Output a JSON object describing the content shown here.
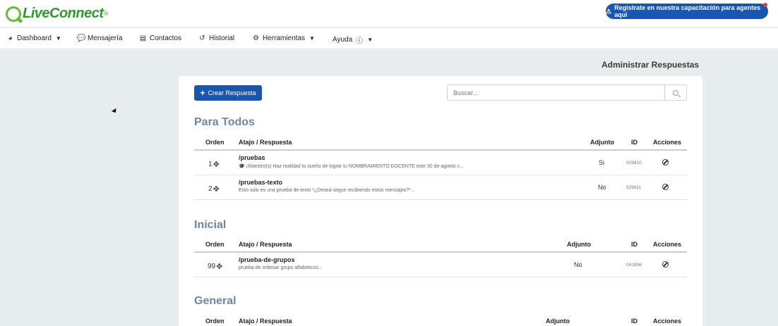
{
  "app": {
    "logo_text": "LiveConnect",
    "logo_mark": "®",
    "cta_label": "Registrate en nuestra capacitación para agentes aqui",
    "cta_icon": "warning-icon"
  },
  "nav": {
    "items": [
      {
        "label": "Dashboard",
        "icon": "dashboard-icon"
      },
      {
        "label": "Mensajería",
        "icon": "chat-icon"
      },
      {
        "label": "Contactos",
        "icon": "contacts-card-icon"
      },
      {
        "label": "Historial",
        "icon": "history-icon"
      },
      {
        "label": "Herramientas",
        "icon": "tools-icon"
      },
      {
        "label": "Ayuda",
        "icon": "help-icon"
      }
    ]
  },
  "page": {
    "title": "Administrar Respuestas",
    "create_button": "Crear Respuesta",
    "search_placeholder": "Buscar..."
  },
  "columns": {
    "orden": "Orden",
    "atajo": "Atajo / Respuesta",
    "adjunto": "Adjunto",
    "id": "ID",
    "acciones": "Acciones"
  },
  "sections": [
    {
      "title": "Para Todos",
      "rows": [
        {
          "orden": "1",
          "name": "/pruebas",
          "desc": "🎓 ¡Maestro(s) Haz realidad tu sueño de lograr tu NOMBRAMIENTO DOCENTE este 30 de agosto c...",
          "adjunto": "Si",
          "id": "029810"
        },
        {
          "orden": "2",
          "name": "/pruebas-texto",
          "desc": "Esto solo es una prueba de texto *¿Desea seguir recibiendo estos mensajes?*...",
          "adjunto": "No",
          "id": "029811"
        }
      ]
    },
    {
      "title": "Inicial",
      "rows": [
        {
          "orden": "99",
          "name": "/prueba-de-grupos",
          "desc": "prueba de ordenar grupo alfabeticos...",
          "adjunto": "No",
          "id": "042896"
        }
      ]
    },
    {
      "title": "General",
      "rows": []
    }
  ]
}
